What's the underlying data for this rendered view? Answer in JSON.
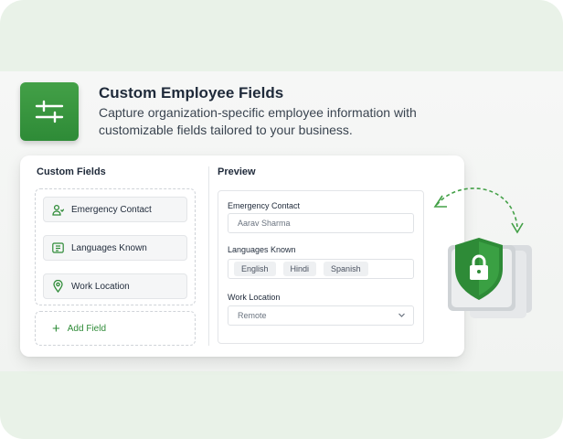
{
  "header": {
    "title": "Custom Employee Fields",
    "subtitle": "Capture organization-specific employee information with customizable fields tailored to your business.",
    "icon": "sliders-icon"
  },
  "custom_fields": {
    "heading": "Custom Fields",
    "items": [
      {
        "label": "Emergency Contact",
        "icon": "contact-icon"
      },
      {
        "label": "Languages Known",
        "icon": "language-icon"
      },
      {
        "label": "Work Location",
        "icon": "location-pin-icon"
      }
    ],
    "add_label": "Add Field"
  },
  "preview": {
    "heading": "Preview",
    "emergency_contact": {
      "label": "Emergency Contact",
      "value": "Aarav Sharma"
    },
    "languages_known": {
      "label": "Languages Known",
      "chips": [
        "English",
        "Hindi",
        "Spanish"
      ]
    },
    "work_location": {
      "label": "Work Location",
      "value": "Remote"
    }
  },
  "colors": {
    "accent": "#2e8b37",
    "background": "#e9f2e8",
    "text": "#1f2a3a"
  }
}
